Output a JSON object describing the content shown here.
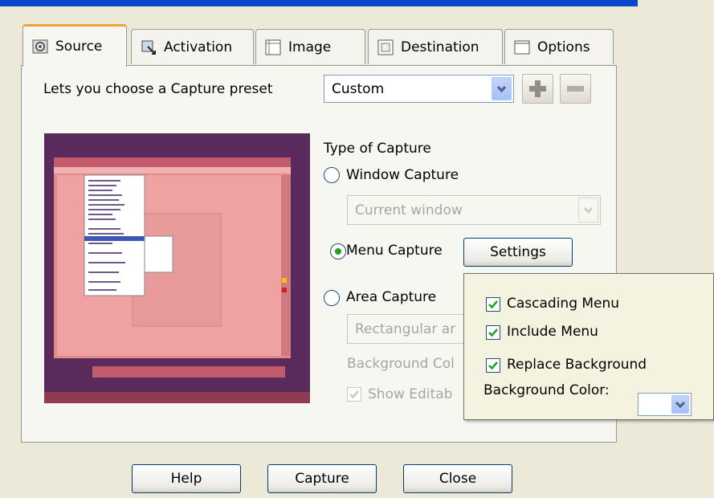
{
  "tabs": [
    {
      "label": "Source",
      "icon": "source-icon"
    },
    {
      "label": "Activation",
      "icon": "activation-icon"
    },
    {
      "label": "Image",
      "icon": "image-icon"
    },
    {
      "label": "Destination",
      "icon": "destination-icon"
    },
    {
      "label": "Options",
      "icon": "options-icon"
    }
  ],
  "preset": {
    "label": "Lets you choose a Capture preset",
    "value": "Custom"
  },
  "capture": {
    "type_label": "Type of Capture",
    "window_label": "Window Capture",
    "window_option": "Current window",
    "menu_label": "Menu Capture",
    "settings_label": "Settings",
    "area_label": "Area Capture",
    "area_option": "Rectangular ar",
    "bg_label": "Background Col",
    "editable_label": "Show Editab"
  },
  "menu_settings": {
    "cascading": "Cascading Menu",
    "include": "Include Menu",
    "replace": "Replace Background",
    "bg_color_label": "Background Color:"
  },
  "footer": {
    "help": "Help",
    "capture": "Capture",
    "close": "Close"
  },
  "colors": {
    "accent": "#f2a337",
    "radio_dot": "#21a121",
    "check": "#21a121",
    "title_bar": "#0a47c9",
    "preview_bg": "#5b2a5c"
  }
}
